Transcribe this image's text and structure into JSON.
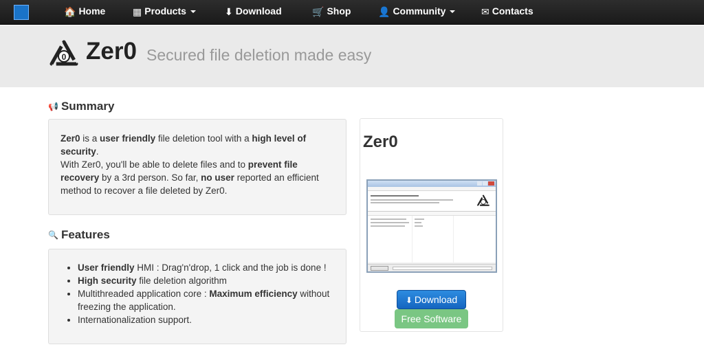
{
  "navbar": {
    "brand_icon": "k-logo-icon",
    "items": [
      {
        "label": "Home",
        "icon": "home-icon",
        "glyph": "🏠"
      },
      {
        "label": "Products",
        "icon": "grid-icon",
        "glyph": "▦",
        "dropdown": true
      },
      {
        "label": "Download",
        "icon": "download-icon",
        "glyph": "⬇"
      },
      {
        "label": "Shop",
        "icon": "cart-icon",
        "glyph": "🛒"
      },
      {
        "label": "Community",
        "icon": "user-icon",
        "glyph": "👤",
        "dropdown": true
      },
      {
        "label": "Contacts",
        "icon": "envelope-icon",
        "glyph": "✉"
      }
    ]
  },
  "hero": {
    "title": "Zer0",
    "tagline": "Secured file deletion made easy",
    "logo_icon": "recycle-zero-logo",
    "logo_text": "0"
  },
  "summary": {
    "heading": "Summary",
    "icon": "megaphone-icon",
    "p1_b1": "Zer0",
    "p1_t1": " is a ",
    "p1_b2": "user friendly",
    "p1_t2": " file deletion tool with a ",
    "p1_b3": "high level of security",
    "p1_t3": ".",
    "p2_t1": "With Zer0, you'll be able to delete files and to ",
    "p2_b1": "prevent file recovery",
    "p2_t2": " by a 3rd person. So far, ",
    "p2_b2": "no user",
    "p2_t3": " reported an efficient method to recover a file deleted by Zer0."
  },
  "features": {
    "heading": "Features",
    "icon": "search-icon",
    "items": [
      {
        "bold": "User friendly",
        "text": " HMI : Drag'n'drop, 1 click and the job is done !"
      },
      {
        "bold": "High security",
        "text": " file deletion algorithm"
      },
      {
        "pre": "Multithreaded application core : ",
        "bold": "Maximum efficiency",
        "text": " without freezing the application."
      },
      {
        "text": "Internationalization support."
      }
    ]
  },
  "panel": {
    "title": "Zer0",
    "download_label": "Download",
    "download_icon": "download-icon",
    "free_label": "Free Software"
  },
  "colors": {
    "navbar": "#1f1f1f",
    "hero_bg": "#eaeaea",
    "download_btn": "#1a73c8",
    "free_btn": "#7ac683"
  }
}
